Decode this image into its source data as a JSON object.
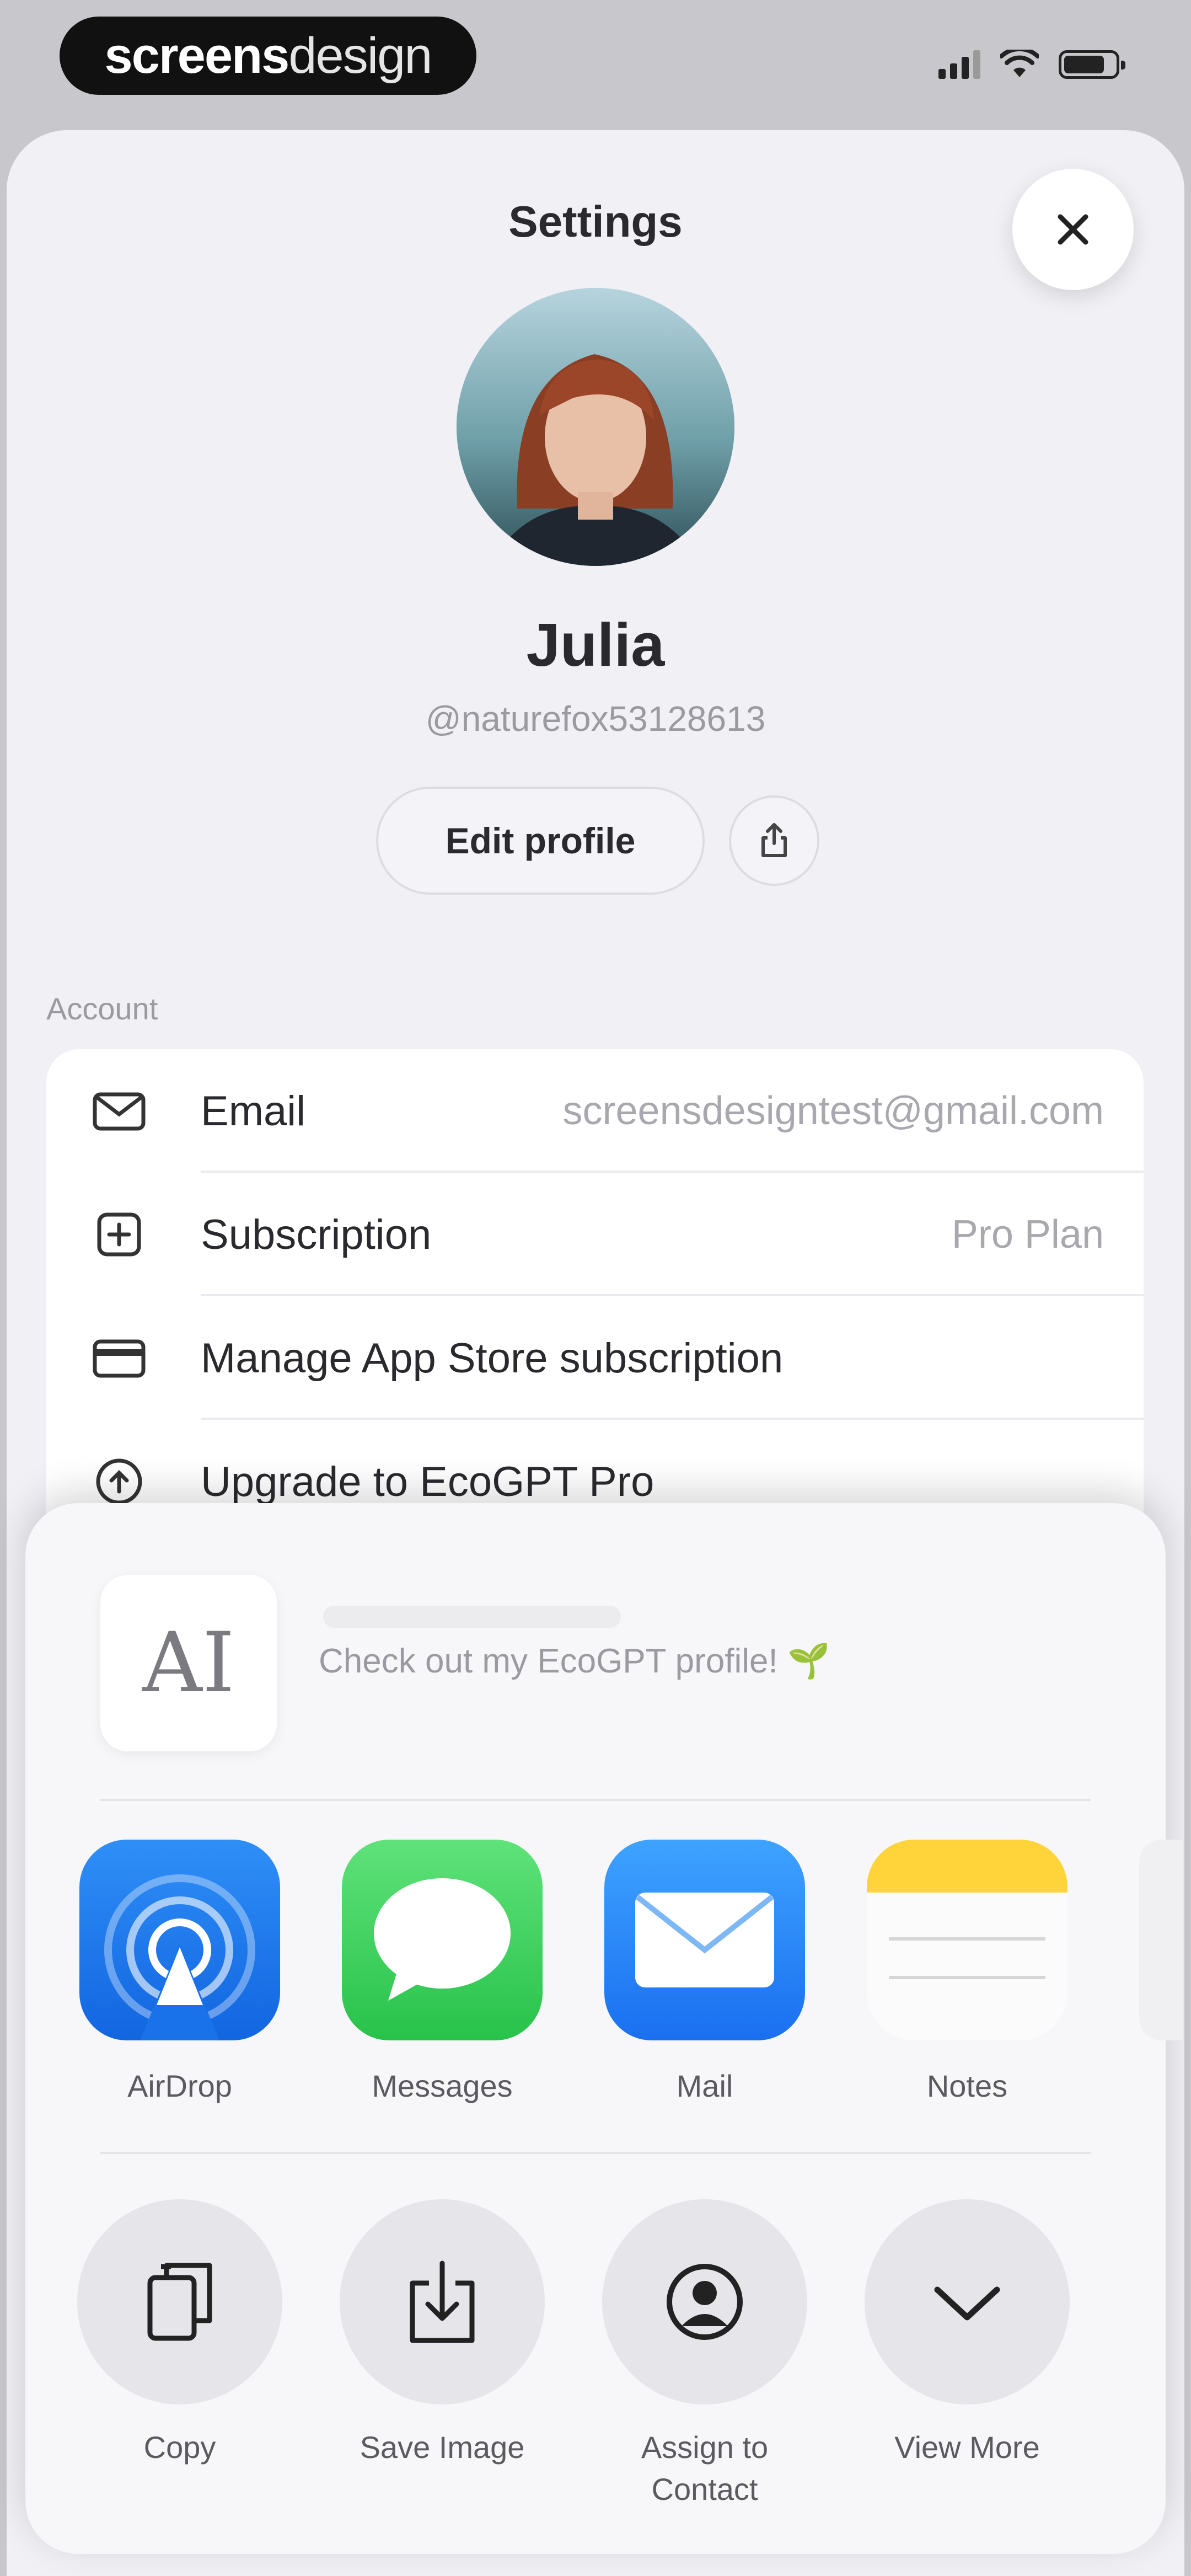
{
  "status_bar": {
    "watermark_bold": "screens",
    "watermark_light": "design"
  },
  "settings": {
    "title": "Settings",
    "profile": {
      "name": "Julia",
      "username": "@naturefox53128613",
      "edit_label": "Edit profile"
    },
    "account_section": {
      "label": "Account",
      "rows": [
        {
          "icon": "mail-icon",
          "label": "Email",
          "value": "screensdesigntest@gmail.com"
        },
        {
          "icon": "plus-square-icon",
          "label": "Subscription",
          "value": "Pro Plan"
        },
        {
          "icon": "credit-card-icon",
          "label": "Manage App Store subscription",
          "value": ""
        },
        {
          "icon": "upgrade-icon",
          "label": "Upgrade to EcoGPT Pro",
          "value": ""
        }
      ]
    }
  },
  "share_sheet": {
    "preview": {
      "thumb_text": "AI",
      "text": "Check out my EcoGPT profile! 🌱"
    },
    "apps": [
      {
        "icon": "airdrop-icon",
        "label": "AirDrop"
      },
      {
        "icon": "messages-icon",
        "label": "Messages"
      },
      {
        "icon": "mail-app-icon",
        "label": "Mail"
      },
      {
        "icon": "notes-icon",
        "label": "Notes"
      }
    ],
    "actions": [
      {
        "icon": "copy-icon",
        "label": "Copy"
      },
      {
        "icon": "save-image-icon",
        "label": "Save Image"
      },
      {
        "icon": "assign-contact-icon",
        "label": "Assign to Contact"
      },
      {
        "icon": "chevron-down-icon",
        "label": "View More"
      }
    ]
  },
  "colors": {
    "airdrop": "#1f7cf2",
    "messages": "#2fd158",
    "mail": "#2a86f5",
    "notes_top": "#ffd43b"
  }
}
